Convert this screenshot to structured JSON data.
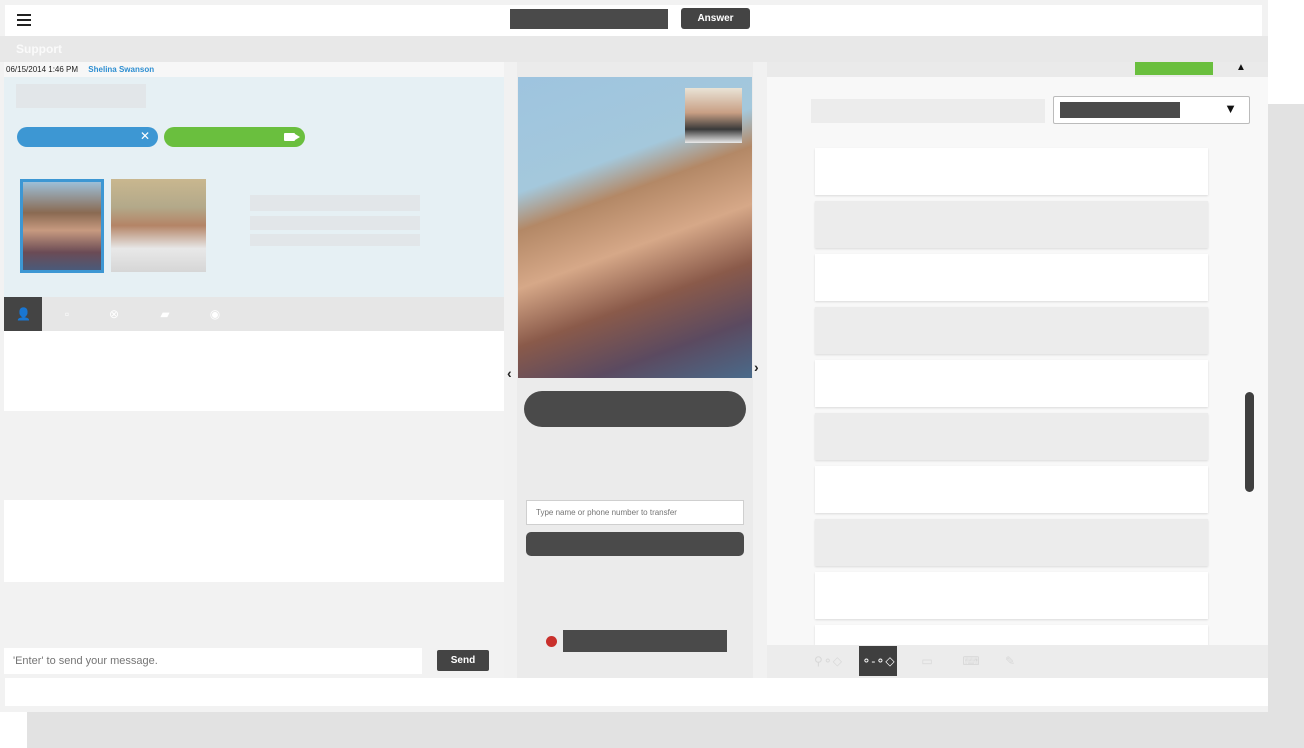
{
  "topbar": {
    "menu_icon": "hamburger-menu-icon",
    "answer_label": "Answer"
  },
  "subbar": {
    "title": "Support"
  },
  "left": {
    "timestamp": "06/15/2014 1:46 PM",
    "contact_name": "Shelina Swanson",
    "blue_pill_icon": "close-icon",
    "green_pill_icon": "video-camera-icon",
    "tabs": [
      {
        "icon": "person-icon",
        "glyph": "👤"
      },
      {
        "icon": "note-icon",
        "glyph": "▫"
      },
      {
        "icon": "close-circle-icon",
        "glyph": "⊗"
      },
      {
        "icon": "chat-bubble-icon",
        "glyph": "▰"
      },
      {
        "icon": "camera-icon",
        "glyph": "◉"
      }
    ],
    "chat_placeholder": "'Enter' to send your message.",
    "send_label": "Send"
  },
  "center": {
    "prev_arrow": "‹",
    "next_arrow": "›",
    "transfer_placeholder": "Type name or phone number to transfer"
  },
  "right": {
    "collapse_glyph": "▲",
    "dropdown_caret": "▼",
    "tools": [
      {
        "icon": "user-workflow-icon",
        "glyph": "⚲⚬◇"
      },
      {
        "icon": "workflow-icon",
        "glyph": "⚬-⚬◇"
      },
      {
        "icon": "window-icon",
        "glyph": "▭"
      },
      {
        "icon": "keyboard-icon",
        "glyph": "⌨"
      },
      {
        "icon": "pen-icon",
        "glyph": "✎"
      }
    ]
  },
  "colors": {
    "accent_blue": "#3d97d3",
    "accent_green": "#6abf3e",
    "dark_button": "#444444",
    "record_red": "#c9302c"
  }
}
